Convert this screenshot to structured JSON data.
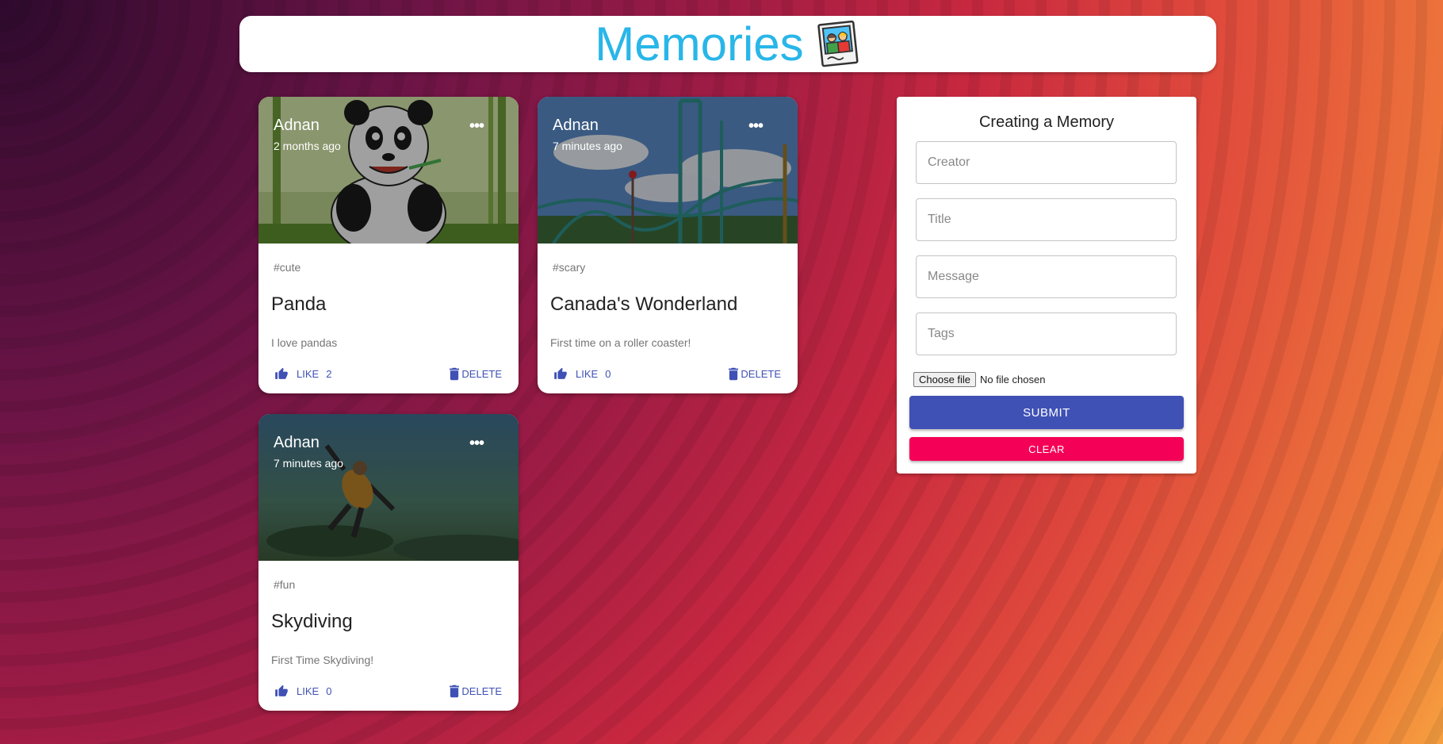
{
  "app": {
    "title": "Memories"
  },
  "posts": [
    {
      "creator": "Adnan",
      "time": "2 months ago",
      "tags": "#cute",
      "title": "Panda",
      "message": "I love pandas",
      "like_label": "LIKE",
      "like_count": "2",
      "delete_label": "DELETE",
      "more": "•••"
    },
    {
      "creator": "Adnan",
      "time": "7 minutes ago",
      "tags": "#scary",
      "title": "Canada's Wonderland",
      "message": "First time on a roller coaster!",
      "like_label": "LIKE",
      "like_count": "0",
      "delete_label": "DELETE",
      "more": "•••"
    },
    {
      "creator": "Adnan",
      "time": "7 minutes ago",
      "tags": "#fun",
      "title": "Skydiving",
      "message": "First Time Skydiving!",
      "like_label": "LIKE",
      "like_count": "0",
      "delete_label": "DELETE",
      "more": "•••"
    }
  ],
  "form": {
    "title": "Creating a Memory",
    "creator_placeholder": "Creator",
    "title_placeholder": "Title",
    "message_placeholder": "Message",
    "tags_placeholder": "Tags",
    "file_button": "Choose file",
    "file_status": "No file chosen",
    "submit_label": "SUBMIT",
    "clear_label": "CLEAR"
  },
  "icons": {
    "logo": "memories-photo-icon",
    "like": "thumb-up-icon",
    "delete": "trash-icon",
    "more": "more-horiz-icon"
  },
  "colors": {
    "title": "#29b6e8",
    "primary": "#3f51b5",
    "secondary": "#f50057"
  }
}
